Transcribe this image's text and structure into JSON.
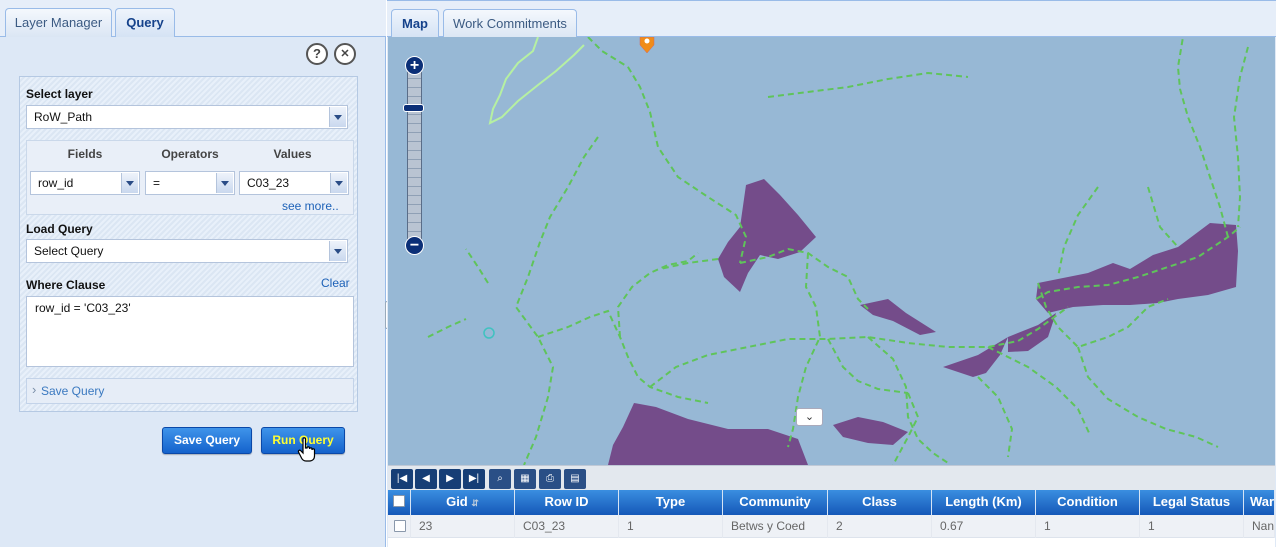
{
  "left_tabs": [
    "Layer Manager",
    "Query"
  ],
  "right_tabs": [
    "Map",
    "Work Commitments"
  ],
  "icons": {
    "help": "?",
    "close": "✕"
  },
  "query": {
    "select_layer_label": "Select layer",
    "layer_value": "RoW_Path",
    "fields_header": "Fields",
    "operators_header": "Operators",
    "values_header": "Values",
    "field_value": "row_id",
    "operator_value": "=",
    "value_value": "C03_23",
    "see_more": "see more..",
    "load_query_label": "Load Query",
    "load_query_value": "Select Query",
    "where_clause_label": "Where Clause",
    "clear": "Clear",
    "where_clause_text": "row_id = 'C03_23'",
    "save_query_section": "Save Query",
    "save_button": "Save Query",
    "run_button": "Run Query"
  },
  "colors": {
    "accent": "#1462cc",
    "run_button_text": "#ffff33",
    "map_water": "#97b8d5",
    "map_area": "#744c8a",
    "map_path": "#5fc45a"
  },
  "map": {
    "zoom_in": "+",
    "zoom_out": "−",
    "collapse_left": "‹",
    "expand_bottom": "⌄"
  },
  "grid": {
    "headers": [
      "Gid",
      "Row ID",
      "Type",
      "Community",
      "Class",
      "Length (Km)",
      "Condition",
      "Legal Status",
      "War"
    ],
    "rows": [
      [
        "23",
        "C03_23",
        "1",
        "Betws y Coed",
        "2",
        "0.67",
        "1",
        "1",
        "Nant"
      ]
    ]
  }
}
